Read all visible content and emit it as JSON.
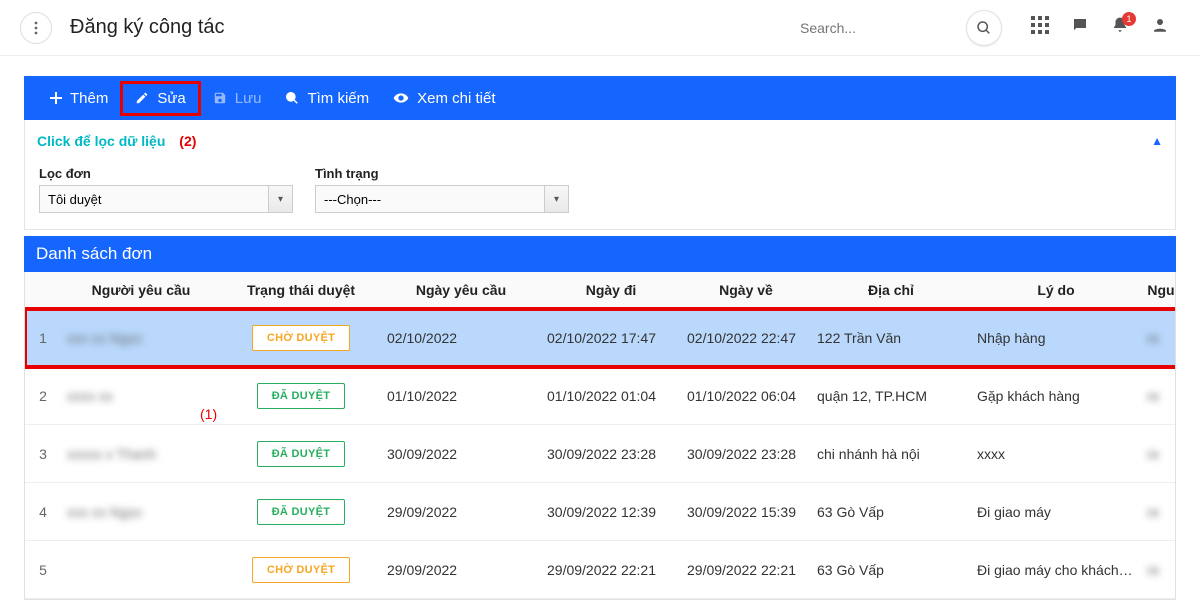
{
  "header": {
    "title": "Đăng ký công tác",
    "search_placeholder": "Search...",
    "notification_count": "1"
  },
  "toolbar": {
    "add": "Thêm",
    "edit": "Sửa",
    "save": "Lưu",
    "search": "Tìm kiếm",
    "view_detail": "Xem chi tiết"
  },
  "filter": {
    "title": "Click để lọc dữ liệu",
    "group1_label": "Lọc đơn",
    "group1_value": "Tôi duyệt",
    "group2_label": "Tình trạng",
    "group2_value": "---Chọn---"
  },
  "section_title": "Danh sách đơn",
  "columns": {
    "requester": "Người yêu cầu",
    "status": "Trạng thái duyệt",
    "request_date": "Ngày yêu cầu",
    "go_date": "Ngày đi",
    "back_date": "Ngày về",
    "address": "Địa chỉ",
    "reason": "Lý do",
    "last": "Ngu"
  },
  "status_labels": {
    "pending": "CHỜ DUYỆT",
    "approved": "ĐÃ DUYỆT"
  },
  "rows": [
    {
      "idx": "1",
      "requester_blur": "xxx xx Ngọc",
      "status": "pending",
      "request_date": "02/10/2022",
      "go": "02/10/2022 17:47",
      "back": "02/10/2022 22:47",
      "address": "122 Trần Văn",
      "reason": "Nhập hàng",
      "selected": true
    },
    {
      "idx": "2",
      "requester_blur": "xxxx xx",
      "status": "approved",
      "request_date": "01/10/2022",
      "go": "01/10/2022 01:04",
      "back": "01/10/2022 06:04",
      "address": "quận 12, TP.HCM",
      "reason": "Gặp khách hàng"
    },
    {
      "idx": "3",
      "requester_blur": "xxxxx x Thanh",
      "status": "approved",
      "request_date": "30/09/2022",
      "go": "30/09/2022 23:28",
      "back": "30/09/2022 23:28",
      "address": "chi nhánh hà nội",
      "reason": "xxxx"
    },
    {
      "idx": "4",
      "requester_blur": "xxx xx Ngọc",
      "status": "approved",
      "request_date": "29/09/2022",
      "go": "30/09/2022 12:39",
      "back": "30/09/2022 15:39",
      "address": "63 Gò Vấp",
      "reason": "Đi giao máy"
    },
    {
      "idx": "5",
      "requester_blur": "",
      "status": "pending",
      "request_date": "29/09/2022",
      "go": "29/09/2022 22:21",
      "back": "29/09/2022 22:21",
      "address": "63 Gò Vấp",
      "reason": "Đi giao máy cho khách acb"
    }
  ],
  "annotations": {
    "a1": "(1)",
    "a2": "(2)"
  }
}
